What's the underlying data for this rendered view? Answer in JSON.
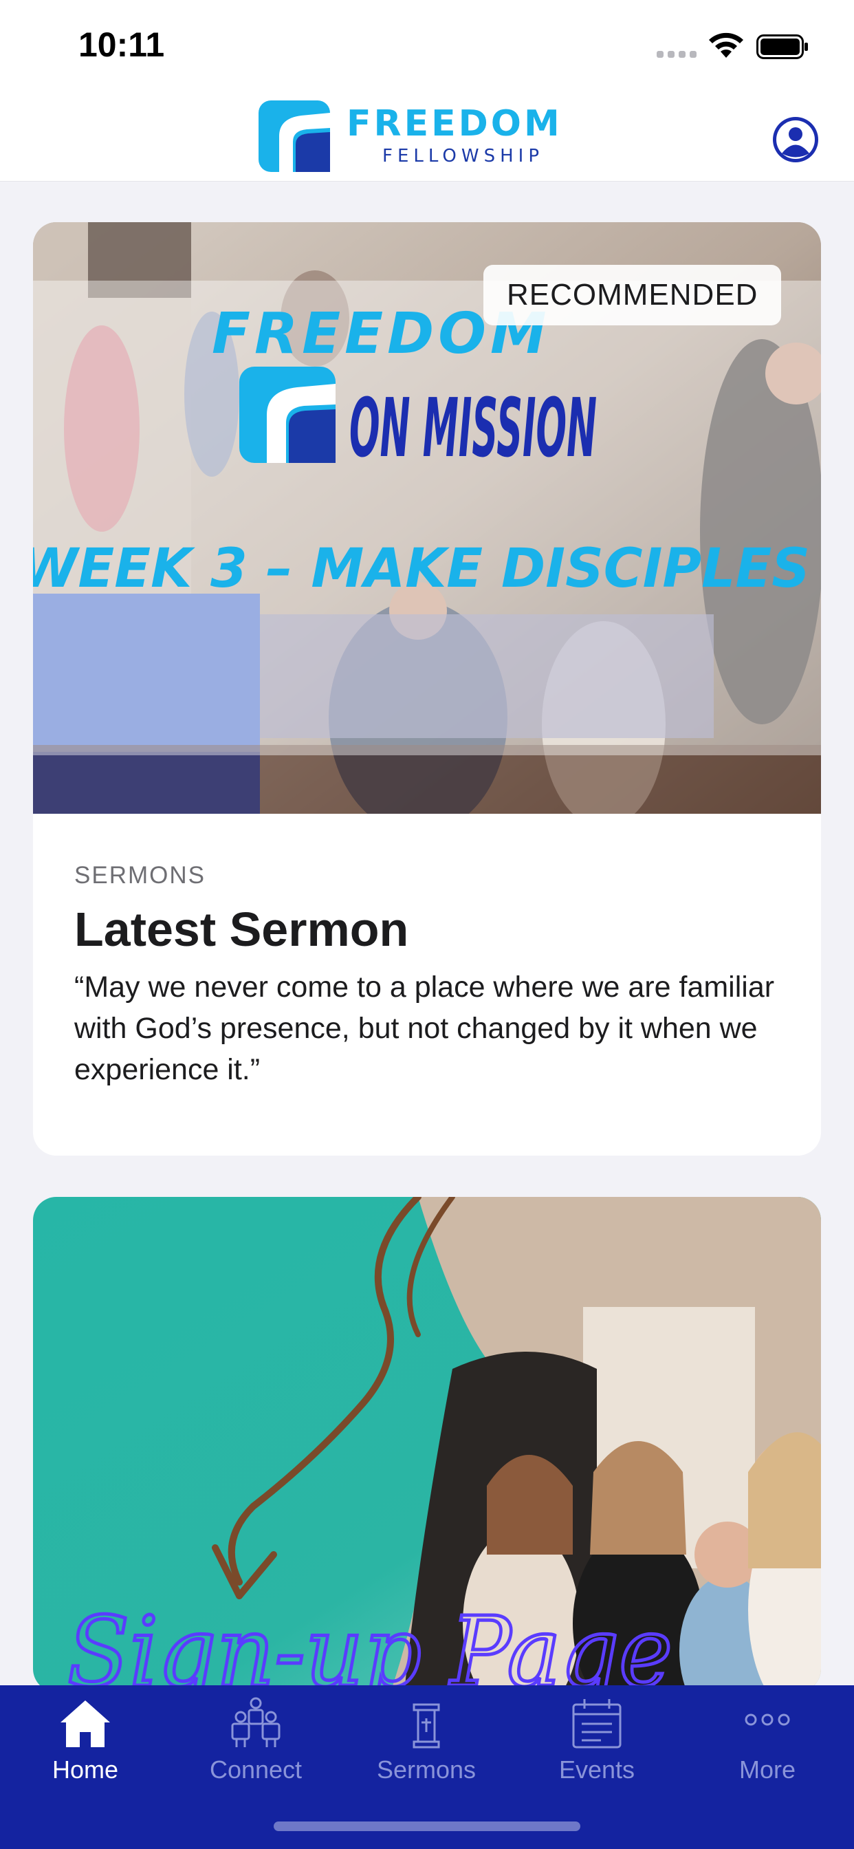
{
  "status_bar": {
    "time": "10:11"
  },
  "header": {
    "logo_title": "FREEDOM",
    "logo_subtitle": "FELLOWSHIP",
    "brand_colors": {
      "cyan": "#1ab2ea",
      "navy": "#1b3aa8"
    }
  },
  "featured_card": {
    "badge": "RECOMMENDED",
    "hero_text": {
      "line1": "FREEDOM",
      "line2": "ON MISSION",
      "line3": "WEEK 3 – MAKE DISCIPLES"
    },
    "category": "SERMONS",
    "title": "Latest Sermon",
    "description": "“May we never come to a place where we are familiar with God’s presence, but not changed by it when we experience it.”"
  },
  "promo_card": {
    "script_text": "Sign-up Page"
  },
  "tab_bar": {
    "background": "#1423a0",
    "tabs": [
      {
        "label": "Home",
        "icon": "house-icon",
        "active": true
      },
      {
        "label": "Connect",
        "icon": "people-icon",
        "active": false
      },
      {
        "label": "Sermons",
        "icon": "pulpit-icon",
        "active": false
      },
      {
        "label": "Events",
        "icon": "calendar-icon",
        "active": false
      },
      {
        "label": "More",
        "icon": "ellipsis-icon",
        "active": false
      }
    ]
  }
}
